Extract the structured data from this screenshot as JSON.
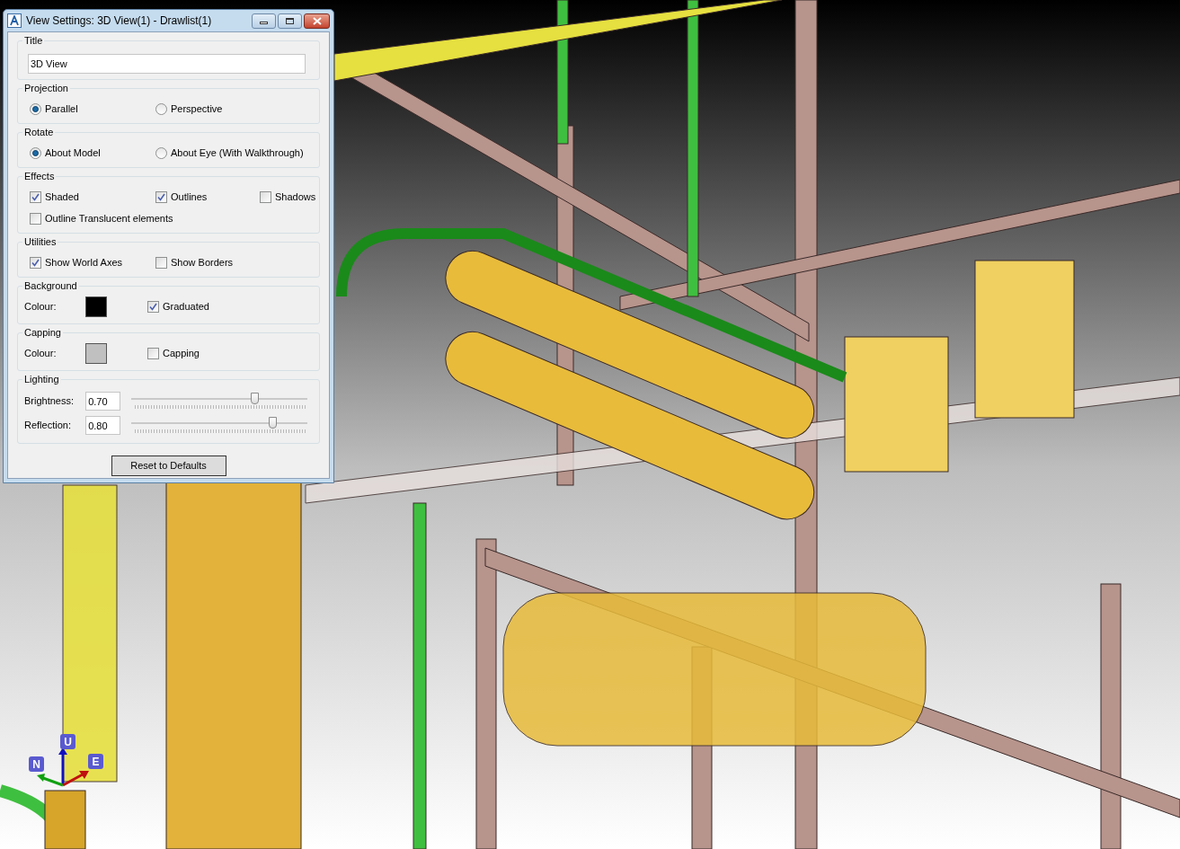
{
  "dialog": {
    "title": "View Settings: 3D View(1) - Drawlist(1)"
  },
  "title_group": {
    "label": "Title",
    "value": "3D View"
  },
  "projection": {
    "label": "Projection",
    "options": [
      {
        "label": "Parallel",
        "selected": true
      },
      {
        "label": "Perspective",
        "selected": false
      }
    ]
  },
  "rotate": {
    "label": "Rotate",
    "options": [
      {
        "label": "About Model",
        "selected": true
      },
      {
        "label": "About Eye (With Walkthrough)",
        "selected": false
      }
    ]
  },
  "effects": {
    "label": "Effects",
    "items": [
      {
        "label": "Shaded",
        "checked": true
      },
      {
        "label": "Outlines",
        "checked": true
      },
      {
        "label": "Shadows",
        "checked": false
      },
      {
        "label": "Outline Translucent elements",
        "checked": false
      }
    ]
  },
  "utilities": {
    "label": "Utilities",
    "items": [
      {
        "label": "Show World Axes",
        "checked": true
      },
      {
        "label": "Show Borders",
        "checked": false
      }
    ]
  },
  "background": {
    "label": "Background",
    "colour_label": "Colour:",
    "color": "#000000",
    "option": {
      "label": "Graduated",
      "checked": true
    }
  },
  "capping": {
    "label": "Capping",
    "colour_label": "Colour:",
    "color": "#c0c0c0",
    "option": {
      "label": "Capping",
      "checked": false
    }
  },
  "lighting": {
    "label": "Lighting",
    "sliders": [
      {
        "label": "Brightness:",
        "value": "0.70",
        "level": 0.7
      },
      {
        "label": "Reflection:",
        "value": "0.80",
        "level": 0.8
      }
    ]
  },
  "reset_button": "Reset to Defaults",
  "axes": [
    {
      "label": "N"
    },
    {
      "label": "U"
    },
    {
      "label": "E"
    }
  ]
}
